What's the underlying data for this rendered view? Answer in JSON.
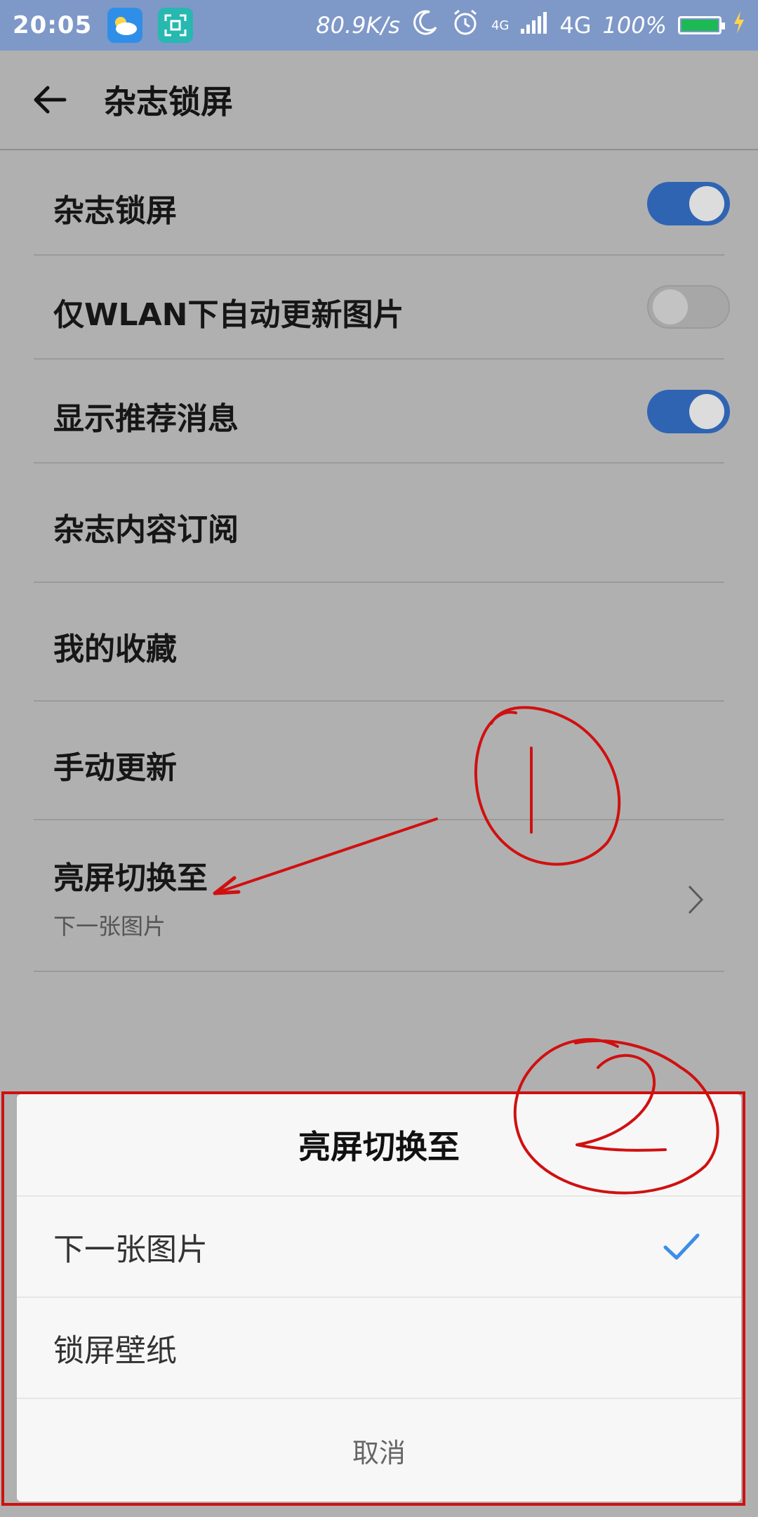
{
  "status_bar": {
    "time": "20:05",
    "net_speed": "80.9K/s",
    "network_small": "4G",
    "network": "4G",
    "battery": "100%",
    "battery_level": 1.0,
    "icons": [
      "weather-app-icon",
      "scan-app-icon",
      "moon-icon",
      "alarm-icon",
      "signal-icon",
      "battery-icon",
      "charging-icon"
    ]
  },
  "header": {
    "title": "杂志锁屏",
    "back_icon": "arrow-left-icon"
  },
  "settings": {
    "magazine_lock": {
      "label": "杂志锁屏",
      "toggle_on": true
    },
    "wlan_only": {
      "label": "仅WLAN下自动更新图片",
      "toggle_on": false
    },
    "show_recommend": {
      "label": "显示推荐消息",
      "toggle_on": true
    },
    "subscription": {
      "label": "杂志内容订阅"
    },
    "favorites": {
      "label": "我的收藏"
    },
    "manual_update": {
      "label": "手动更新"
    },
    "screen_switch": {
      "label": "亮屏切换至",
      "value": "下一张图片"
    }
  },
  "sheet": {
    "title": "亮屏切换至",
    "options": [
      {
        "label": "下一张图片",
        "selected": true
      },
      {
        "label": "锁屏壁纸",
        "selected": false
      }
    ],
    "cancel": "取消"
  },
  "colors": {
    "status_bar": "#7e98c8",
    "toggle_on": "#2f64b3",
    "check": "#3d8de8",
    "annotation": "#d01010"
  }
}
